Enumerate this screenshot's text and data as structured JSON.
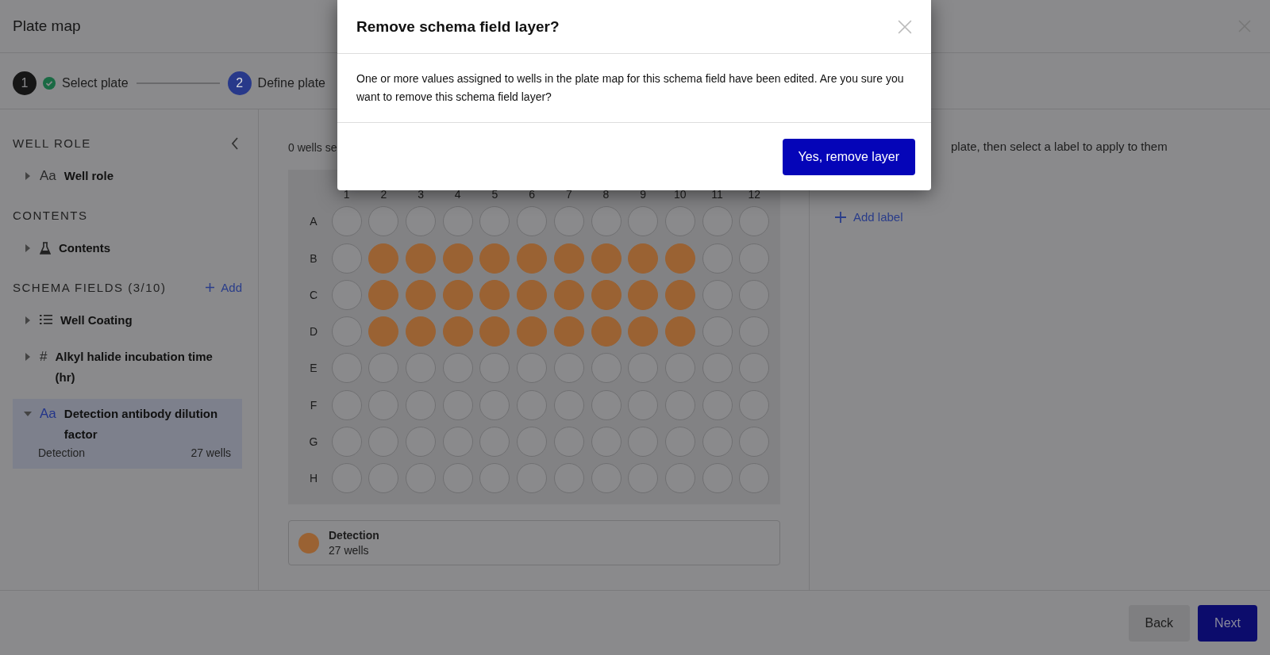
{
  "window": {
    "title": "Plate map"
  },
  "stepper": [
    {
      "number": "1",
      "label": "Select plate",
      "completed": true,
      "selected": false
    },
    {
      "number": "2",
      "label": "Define plate",
      "completed": false,
      "selected": true
    }
  ],
  "sidebar": {
    "sections": [
      {
        "title": "WELL ROLE",
        "collapse": true,
        "items": [
          {
            "label": "Well role",
            "kind": "text",
            "glyph": "Aa",
            "expanded": false,
            "selected": false
          }
        ]
      },
      {
        "title": "CONTENTS",
        "items": [
          {
            "label": "Contents",
            "kind": "flask",
            "expanded": false,
            "selected": false
          }
        ]
      },
      {
        "title": "SCHEMA FIELDS (3/10)",
        "add_link": "Add",
        "items": [
          {
            "label": "Well Coating",
            "kind": "list",
            "expanded": false,
            "selected": false
          },
          {
            "label": "Alkyl halide incubation time (hr)",
            "kind": "number",
            "glyph": "#",
            "expanded": false,
            "selected": false
          },
          {
            "label": "Detection antibody dilution factor",
            "kind": "text",
            "glyph": "Aa",
            "expanded": true,
            "selected": true,
            "children": [
              {
                "label": "Detection",
                "count": "27 wells"
              }
            ]
          }
        ]
      }
    ]
  },
  "plate": {
    "selection_text": "0 wells se",
    "columns": [
      "1",
      "2",
      "3",
      "4",
      "5",
      "6",
      "7",
      "8",
      "9",
      "10",
      "11",
      "12"
    ],
    "rows": [
      {
        "label": "A",
        "wells": [
          false,
          false,
          false,
          false,
          false,
          false,
          false,
          false,
          false,
          false,
          false,
          false
        ]
      },
      {
        "label": "B",
        "wells": [
          false,
          true,
          true,
          true,
          true,
          true,
          true,
          true,
          true,
          true,
          false,
          false
        ]
      },
      {
        "label": "C",
        "wells": [
          false,
          true,
          true,
          true,
          true,
          true,
          true,
          true,
          true,
          true,
          false,
          false
        ]
      },
      {
        "label": "D",
        "wells": [
          false,
          true,
          true,
          true,
          true,
          true,
          true,
          true,
          true,
          true,
          false,
          false
        ]
      },
      {
        "label": "E",
        "wells": [
          false,
          false,
          false,
          false,
          false,
          false,
          false,
          false,
          false,
          false,
          false,
          false
        ]
      },
      {
        "label": "F",
        "wells": [
          false,
          false,
          false,
          false,
          false,
          false,
          false,
          false,
          false,
          false,
          false,
          false
        ]
      },
      {
        "label": "G",
        "wells": [
          false,
          false,
          false,
          false,
          false,
          false,
          false,
          false,
          false,
          false,
          false,
          false
        ]
      },
      {
        "label": "H",
        "wells": [
          false,
          false,
          false,
          false,
          false,
          false,
          false,
          false,
          false,
          false,
          false,
          false
        ]
      }
    ],
    "legend": [
      {
        "label": "Detection",
        "count": "27 wells",
        "color": "#9a6233"
      }
    ]
  },
  "right_panel": {
    "instruction": "plate, then select a label to apply to them",
    "add_label": "Add label"
  },
  "footer": {
    "buttons": [
      {
        "label": "Back",
        "kind": "secondary"
      },
      {
        "label": "Next",
        "kind": "primary"
      }
    ]
  },
  "modal": {
    "title": "Remove schema field layer?",
    "message": "One or more values assigned to wells in the plate map for this schema field have been edited. Are you sure you want to remove this schema field layer?",
    "confirm": "Yes, remove layer"
  }
}
